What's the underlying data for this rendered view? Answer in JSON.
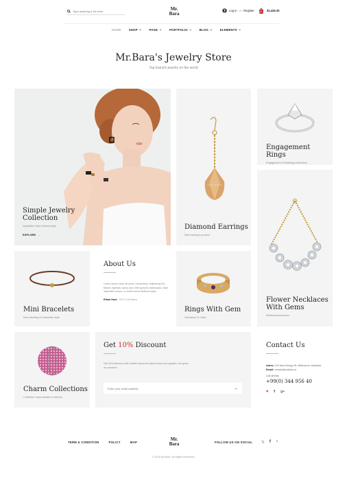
{
  "header": {
    "search_placeholder": "Type anything & hit enter",
    "logo_line1": "Mr.",
    "logo_line2": "Bara",
    "login": "Log in",
    "or": "or",
    "register": "Register",
    "cart_total": "$2,426.30",
    "cart_count": "2"
  },
  "nav": [
    {
      "label": "HOME"
    },
    {
      "label": "SHOP"
    },
    {
      "label": "PAGE"
    },
    {
      "label": "PORTFOLIO"
    },
    {
      "label": "BLOG"
    },
    {
      "label": "ELEMENTS"
    }
  ],
  "hero": {
    "title": "Mr.Bara's Jewelry Store",
    "subtitle": "Top brand's jewelry on the world"
  },
  "cards": {
    "simple": {
      "title": "Simple Jewelry Collection",
      "desc": "Inspiration from minimal style",
      "cta": "EXPLORE"
    },
    "diamond": {
      "title": "Diamond Earrings",
      "desc": "New earring's product"
    },
    "engagement": {
      "title": "Engagement Rings",
      "desc": "Engagement & Wedding collections"
    },
    "bracelets": {
      "title": "Mini Bracelets",
      "desc": "New trending for bracelets style"
    },
    "about": {
      "title": "About Us",
      "text": "Lorem ipsum dolor sit amet, consectetur adipiscing elit. Mauris egestas varius arcu nibh gravida malesuada. Nam imperdiet cursus. In mollis lorem eleifend turpis.",
      "author": "Ethan Hunt",
      "role": "CEO of Mr.Bara"
    },
    "gem": {
      "title": "Rings With Gem",
      "desc": "Gemstone & Cities"
    },
    "necklace": {
      "title": "Flower Necklaces With Gems",
      "desc": "Mistical accessories"
    },
    "charm": {
      "title": "Charm Collections",
      "desc": "Collection most wanted of citizens"
    },
    "discount": {
      "title_pre": "Get ",
      "title_pct": "10%",
      "title_post": " Discount",
      "text": "Get 10% discount with notified about the latest news and updates. No spam, we promise !",
      "email_placeholder": "Enter your email address"
    },
    "contact": {
      "title": "Contact Us",
      "address_label": "Adres:",
      "address": "123 New Design St, Melbourne, Australia",
      "email_label": "Email:",
      "email": "contact@mrbara.co",
      "call_label": "Call directly",
      "phone": "+99(0) 344 956 40"
    }
  },
  "footer": {
    "links": [
      "TERM & CONDITION",
      "POLICY",
      "MAP"
    ],
    "logo_line1": "Mr.",
    "logo_line2": "Bara",
    "follow": "FOLLOW US ON SOCIAL",
    "copyright": "© 2016 Mr.Bara. All Rights Reserved."
  },
  "colors": {
    "accent": "#c4302b",
    "card_bg": "#f3f4f3"
  }
}
